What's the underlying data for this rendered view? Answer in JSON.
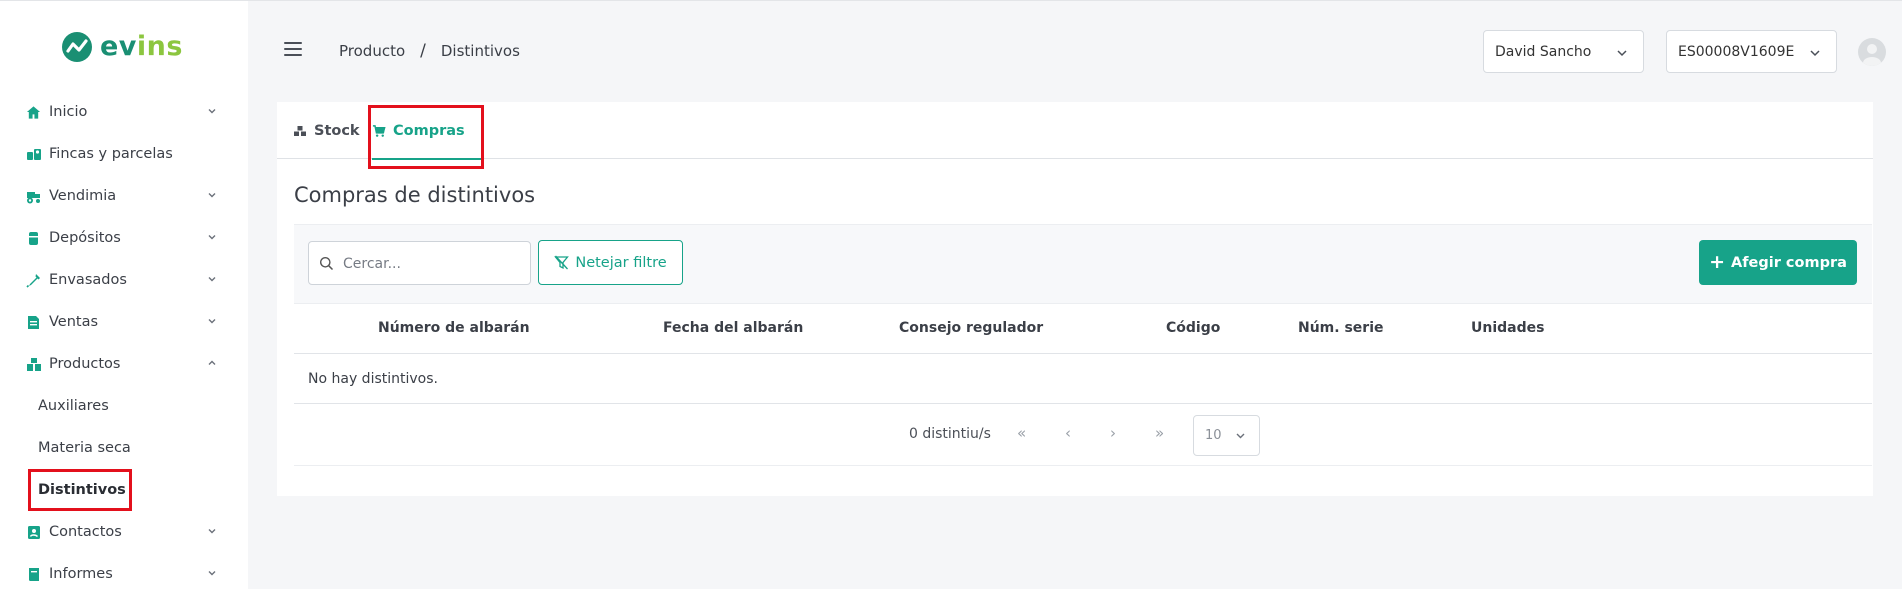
{
  "brand": {
    "name_main": "ev",
    "name_accent": "ins"
  },
  "sidebar": {
    "items": [
      {
        "label": "Inicio",
        "icon": "home-icon",
        "expandable": true
      },
      {
        "label": "Fincas y parcelas",
        "icon": "parcels-icon",
        "expandable": false
      },
      {
        "label": "Vendimia",
        "icon": "tractor-icon",
        "expandable": true
      },
      {
        "label": "Depósitos",
        "icon": "tank-icon",
        "expandable": true
      },
      {
        "label": "Envasados",
        "icon": "bottle-icon",
        "expandable": true
      },
      {
        "label": "Ventas",
        "icon": "invoice-icon",
        "expandable": true
      },
      {
        "label": "Productos",
        "icon": "boxes-icon",
        "expandable": true,
        "expanded": true
      },
      {
        "label": "Contactos",
        "icon": "contact-icon",
        "expandable": true
      },
      {
        "label": "Informes",
        "icon": "book-icon",
        "expandable": true
      }
    ],
    "sub_items": [
      {
        "label": "Auxiliares",
        "active": false
      },
      {
        "label": "Materia seca",
        "active": false
      },
      {
        "label": "Distintivos",
        "active": true
      }
    ]
  },
  "header": {
    "breadcrumb": [
      "Producto",
      "Distintivos"
    ],
    "breadcrumb_separator": "/",
    "user_select": "David Sancho",
    "code_select": "ES00008V1609E"
  },
  "tabs": [
    {
      "label": "Stock",
      "icon": "stock-icon",
      "active": false
    },
    {
      "label": "Compras",
      "icon": "cart-icon",
      "active": true
    }
  ],
  "main": {
    "title": "Compras de distintivos",
    "search_placeholder": "Cercar...",
    "clear_filter_label": "Netejar filtre",
    "add_button_label": "Afegir compra",
    "add_button_symbol": "+",
    "table": {
      "columns": [
        "Número de albarán",
        "Fecha del albarán",
        "Consejo regulador",
        "Código",
        "Núm. serie",
        "Unidades"
      ],
      "empty_message": "No hay distintivos."
    },
    "pagination": {
      "count_label": "0 distintiu/s",
      "first": "«",
      "prev": "‹",
      "next": "›",
      "last": "»",
      "page_size": "10"
    }
  },
  "colors": {
    "accent": "#17a389",
    "brand_dark": "#1a8f73",
    "brand_light": "#8cc63f",
    "highlight": "#e3101c"
  }
}
